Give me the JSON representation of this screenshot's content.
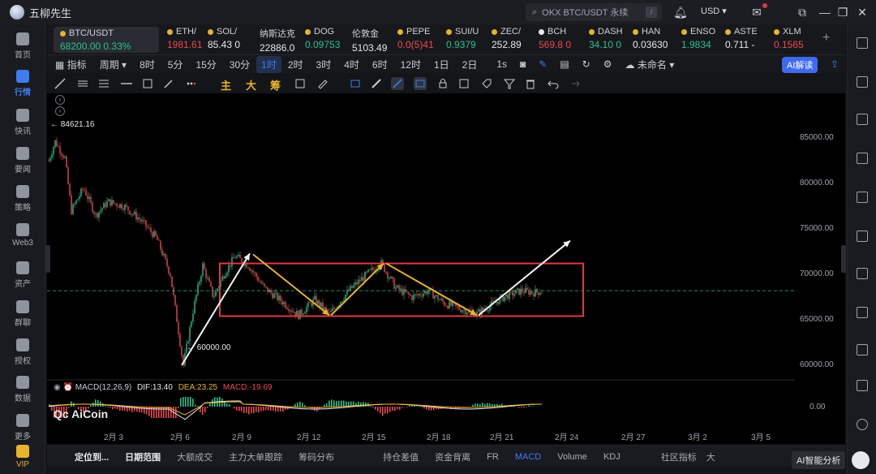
{
  "app": {
    "title": "五柳先生"
  },
  "search": {
    "text": "OKX BTC/USDT 永续",
    "shortcut": "/"
  },
  "currency": "USD",
  "sidebar": {
    "items": [
      {
        "label": "首页"
      },
      {
        "label": "行情"
      },
      {
        "label": "快讯"
      },
      {
        "label": "要闻"
      },
      {
        "label": "策略"
      },
      {
        "label": "Web3"
      },
      {
        "label": "资产"
      },
      {
        "label": "群聊"
      },
      {
        "label": "授权"
      },
      {
        "label": "数据"
      },
      {
        "label": "更多"
      },
      {
        "label": "VIP"
      }
    ]
  },
  "tickers": [
    {
      "name": "BTC/USDT",
      "price": "68200.00",
      "change": "0.33%"
    },
    {
      "name": "ETH/",
      "price": "1981.61"
    },
    {
      "name": "SOL/",
      "price": "85.43 0"
    },
    {
      "name": "纳斯达克",
      "price": "22886.0"
    },
    {
      "name": "DOG",
      "price": "0.09753"
    },
    {
      "name": "伦敦金",
      "price": "5103.49"
    },
    {
      "name": "PEPE",
      "price": "0.0(5)41"
    },
    {
      "name": "SUI/U",
      "price": "0.9379"
    },
    {
      "name": "ZEC/",
      "price": "252.89"
    },
    {
      "name": "BCH",
      "price": "569.8 0"
    },
    {
      "name": "DASH",
      "price": "34.10 0"
    },
    {
      "name": "HAN",
      "price": "0.03630"
    },
    {
      "name": "ENSO",
      "price": "1.9834"
    },
    {
      "name": "ASTE",
      "price": "0.711 -"
    },
    {
      "name": "XLM",
      "price": "0.1565"
    }
  ],
  "toolbar": {
    "indicator": "指标",
    "period": "周期",
    "timeframes": [
      "8时",
      "5分",
      "15分",
      "30分",
      "1时",
      "2时",
      "3时",
      "4时",
      "6时",
      "12时",
      "1日",
      "2日",
      "1s"
    ],
    "active_tf": "1时",
    "layout_name": "未命名",
    "ai_button": "AI解读"
  },
  "drawing_tools": {
    "main": "主",
    "big": "大",
    "chips": "筹"
  },
  "chart_data": {
    "type": "candlestick",
    "symbol": "BTC/USDT",
    "y_ticks": [
      85000,
      80000,
      75000,
      70000,
      65000,
      60000
    ],
    "y_tick_labels": [
      "85000.00",
      "80000.00",
      "75000.00",
      "70000.00",
      "65000.00",
      "60000.00"
    ],
    "x_tick_labels": [
      "2月 3",
      "2月 6",
      "2月 9",
      "2月 12",
      "2月 15",
      "2月 18",
      "2月 21",
      "2月 24",
      "2月 27",
      "3月 2",
      "3月 5"
    ],
    "ylim": [
      57000,
      88000
    ],
    "annotations": {
      "high": "84621.16",
      "low": "60000.00"
    },
    "current_price": 68200,
    "macd": {
      "label": "MACD(12,26,9)",
      "dif": "DIF:13.40",
      "dea": "DEA:23.25",
      "macd": "MACD:-19.69",
      "zero_label": "0.00"
    },
    "watermark": "AiCoin"
  },
  "bottom_tabs": [
    "定位到...",
    "日期范围",
    "大额成交",
    "主力大单跟踪",
    "筹码分布",
    "持仓差值",
    "资金背离",
    "FR",
    "MACD",
    "Volume",
    "KDJ",
    "社区指标",
    "大"
  ],
  "bottom_active": "MACD",
  "ai_analyze": "AI智能分析",
  "colors": {
    "accent": "#3e7cf0",
    "up": "#2bc08b",
    "down": "#e84a52",
    "box": "#e0383e",
    "arrow": "#e7b32c"
  }
}
